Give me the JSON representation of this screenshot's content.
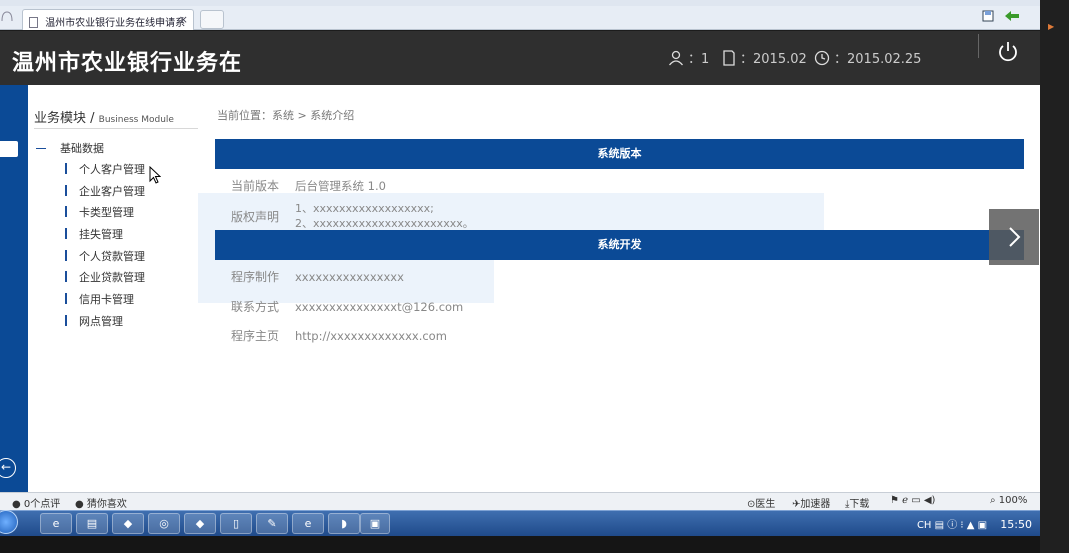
{
  "browser": {
    "tab_title": "温州市农业银行业务在线申请系",
    "tab_close": "×"
  },
  "header": {
    "title": "温州市农业银行业务在",
    "user_count": "：1",
    "version_month": "：2015.02",
    "date": "：2015.02.25"
  },
  "sidebar": {
    "title": "业务模块",
    "title_sep": " / ",
    "title_en": "Business Module",
    "group": "基础数据",
    "items": [
      {
        "label": "个人客户管理"
      },
      {
        "label": "企业客户管理"
      },
      {
        "label": "卡类型管理"
      },
      {
        "label": "挂失管理"
      },
      {
        "label": "个人贷款管理"
      },
      {
        "label": "企业贷款管理"
      },
      {
        "label": "信用卡管理"
      },
      {
        "label": "网点管理"
      }
    ]
  },
  "main": {
    "breadcrumb": "当前位置：系统 > 系统介绍",
    "section_version": {
      "title": "系统版本",
      "current_label": "当前版本",
      "current_value": "后台管理系统 1.0",
      "copyright_label": "版权声明",
      "copyright_lines": [
        "1、xxxxxxxxxxxxxxxxxx;",
        "2、xxxxxxxxxxxxxxxxxxxxxxx。"
      ]
    },
    "section_dev": {
      "title": "系统开发",
      "maker_label": "程序制作",
      "maker_value": "xxxxxxxxxxxxxxxx",
      "contact_label": "联系方式",
      "contact_value": "xxxxxxxxxxxxxxxt@126.com",
      "home_label": "程序主页",
      "home_value": "http://xxxxxxxxxxxxx.com"
    }
  },
  "statusbar": {
    "comments": "0个点评",
    "guess": "猜你喜欢",
    "doctor": "医生",
    "accelerator": "加速器",
    "download": "下载",
    "zoom": "100%"
  },
  "taskbar": {
    "ime": "CH",
    "time": "15:50"
  },
  "colors": {
    "accent_blue": "#0b4a96",
    "header_dark": "#2f2f2f"
  }
}
